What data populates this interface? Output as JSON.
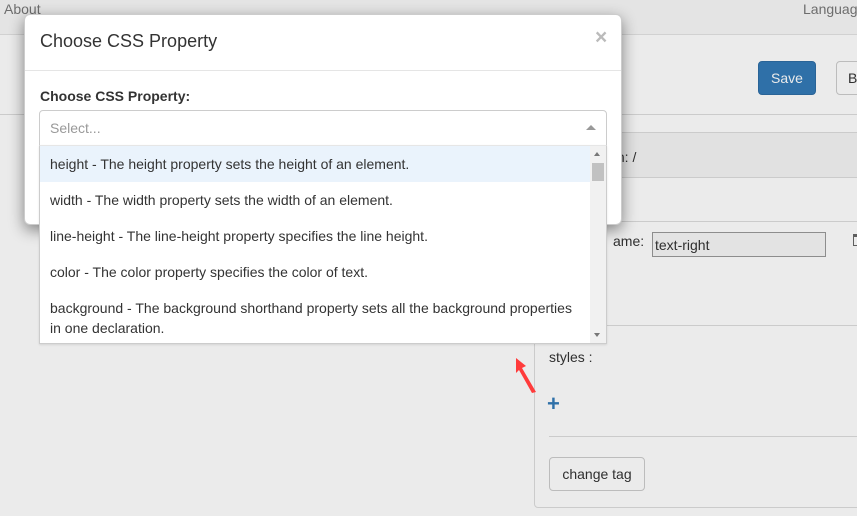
{
  "topbar": {
    "about": "About",
    "language": "Languag"
  },
  "toolbar": {
    "save_label": "Save",
    "other_label": "B"
  },
  "panel": {
    "path_text": "th: /",
    "classname_label": "ame:",
    "classname_value": "text-right",
    "styles_label": "styles :",
    "change_tag_label": "change tag"
  },
  "modal": {
    "title": "Choose CSS Property",
    "close_glyph": "×",
    "field_label": "Choose CSS Property:",
    "select": {
      "placeholder": "Select...",
      "options": [
        "height - The height property sets the height of an element.",
        "width - The width property sets the width of an element.",
        "line-height - The line-height property specifies the line height.",
        "color - The color property specifies the color of text.",
        "background - The background shorthand property sets all the background properties in one declaration."
      ],
      "highlighted_index": 0
    }
  },
  "colors": {
    "primary": "#337ab7",
    "highlight": "#eaf3fc",
    "arrow": "#ff3b3b"
  },
  "icons": {
    "close": "close-icon",
    "caret": "caret-up-icon",
    "plus": "plus-icon",
    "arrow": "arrow-icon",
    "trash": "trash-icon"
  }
}
